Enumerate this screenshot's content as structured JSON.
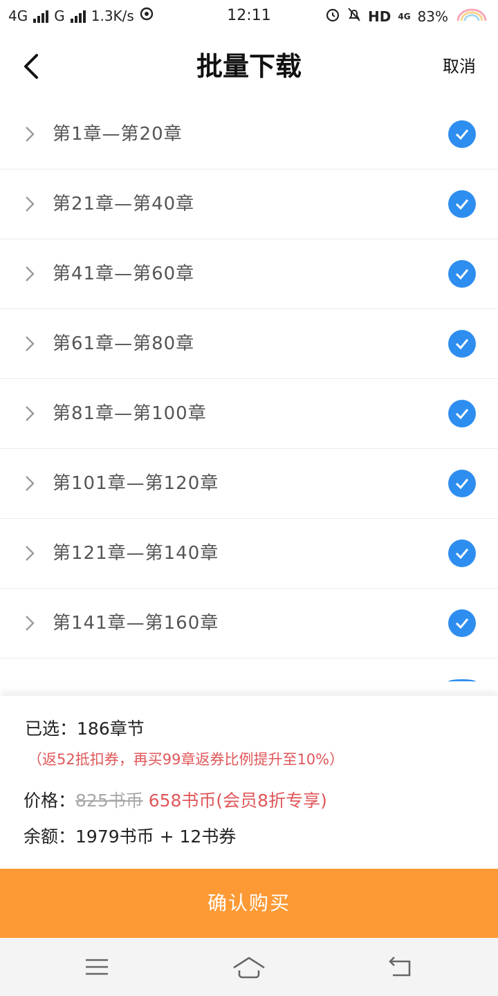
{
  "status": {
    "network1": "4G",
    "network2": "G",
    "speed": "1.3K/s",
    "time": "12:11",
    "hd": "HD",
    "net_small": "4G",
    "battery": "83%"
  },
  "header": {
    "title": "批量下载",
    "cancel": "取消"
  },
  "chapters": [
    {
      "label": "第1章—第20章",
      "checked": true
    },
    {
      "label": "第21章—第40章",
      "checked": true
    },
    {
      "label": "第41章—第60章",
      "checked": true
    },
    {
      "label": "第61章—第80章",
      "checked": true
    },
    {
      "label": "第81章—第100章",
      "checked": true
    },
    {
      "label": "第101章—第120章",
      "checked": true
    },
    {
      "label": "第121章—第140章",
      "checked": true
    },
    {
      "label": "第141章—第160章",
      "checked": true
    }
  ],
  "summary": {
    "selected_prefix": "已选：",
    "selected_value": "186章节",
    "promo": "（返52抵扣券，再买99章返券比例提升至10%）",
    "price_prefix": "价格：",
    "original_price": "825书币",
    "sale_price": "658书币(会员8折专享)",
    "balance_prefix": "余额：",
    "balance_value": "1979书币 + 12书券"
  },
  "confirm_label": "确认购买",
  "colors": {
    "accent_blue": "#2e8ef0",
    "button_orange": "#fd9a35",
    "promo_red": "#e0575a"
  },
  "icons": {
    "back": "chevron-left-icon",
    "row": "chevron-right-icon",
    "check": "check-circle-icon",
    "nav_menu": "menu-icon",
    "nav_home": "home-icon",
    "nav_back": "back-arrow-icon"
  }
}
